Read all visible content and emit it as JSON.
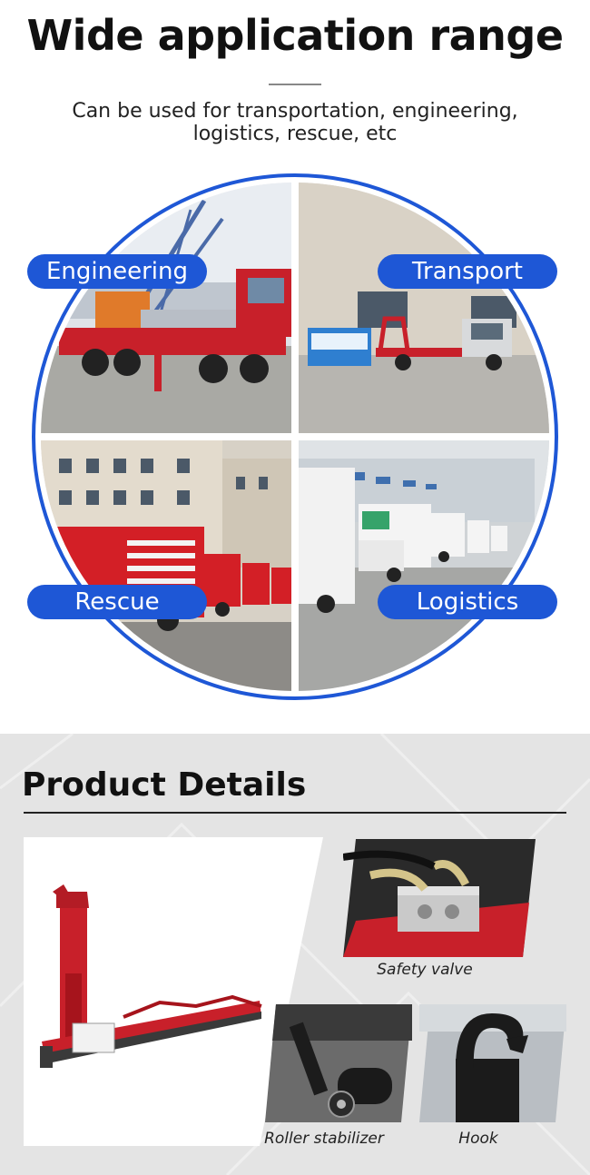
{
  "header": {
    "title": "Wide application range",
    "subtitle": "Can be used for transportation, engineering, logistics, rescue, etc"
  },
  "applications": [
    {
      "label": "Engineering"
    },
    {
      "label": "Transport"
    },
    {
      "label": "Rescue"
    },
    {
      "label": "Logistics"
    }
  ],
  "details": {
    "title": "Product Details",
    "captions": {
      "valve": "Safety valve",
      "roller": "Roller stabilizer",
      "hook": "Hook"
    }
  },
  "colors": {
    "accent": "#1e57d6",
    "truck_red": "#c8202a"
  }
}
